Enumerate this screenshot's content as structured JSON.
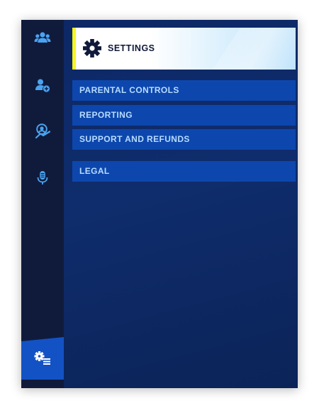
{
  "header": {
    "title": "SETTINGS",
    "icon": "gear-icon"
  },
  "menu": {
    "items": [
      {
        "label": "PARENTAL CONTROLS"
      },
      {
        "label": "REPORTING"
      },
      {
        "label": "SUPPORT AND REFUNDS"
      },
      {
        "label": "LEGAL"
      }
    ]
  },
  "sidebar": {
    "icons": [
      "friends-icon",
      "add-friend-icon",
      "party-icon",
      "voice-chat-icon"
    ],
    "active_icon": "settings-list-icon"
  },
  "colors": {
    "background": "#0c2660",
    "rail": "#101b3c",
    "menu_item": "#0d47ad",
    "menu_text": "#b7dcff",
    "accent_yellow": "#f4f623",
    "active_tab": "#1352c4",
    "icon": "#4aa3f0"
  }
}
